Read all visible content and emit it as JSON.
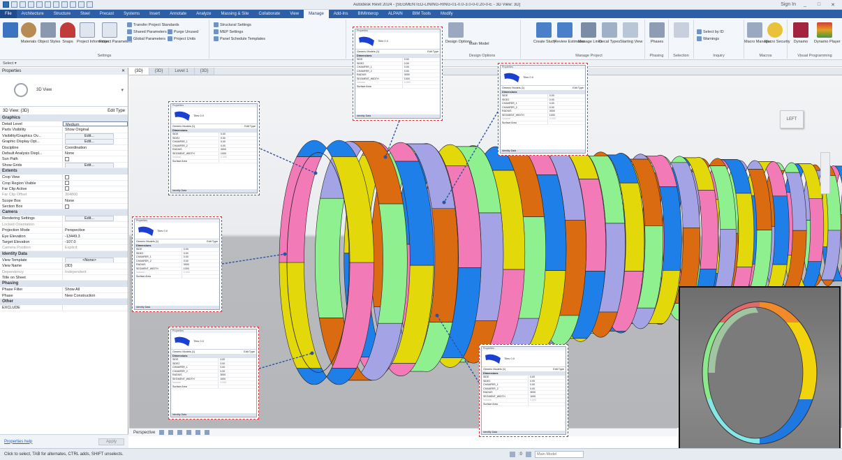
{
  "window": {
    "title": "Autodesk Revit 2024 - [SEGMENTED-LINING-RING-01-0.0-3.0-0-0.20-0-E - 3D View: 3D]",
    "user_label": "Sign In",
    "min": "_",
    "max": "□",
    "close": "✕"
  },
  "ribbon_tabs": [
    "File",
    "Architecture",
    "Structure",
    "Steel",
    "Precast",
    "Systems",
    "Insert",
    "Annotate",
    "Analyze",
    "Massing & Site",
    "Collaborate",
    "View",
    "Manage",
    "Add-Ins",
    "BIMInterop",
    "ALPAIN",
    "BIM Tools",
    "Modify"
  ],
  "active_tab": "Manage",
  "ribbon": {
    "settings": {
      "materials": "Materials",
      "object_styles": "Object Styles",
      "snaps": "Snaps",
      "project_info": "Project Information",
      "project_params": "Project Parameters",
      "shared_params": "Shared Parameters",
      "global_params": "Global Parameters",
      "transfer_standards": "Transfer Project Standards",
      "purge_unused": "Purge Unused",
      "project_units": "Project Units",
      "structural_settings": "Structural Settings",
      "mep_settings": "MEP Settings",
      "panel_schedule": "Panel Schedule Templates",
      "group": "Settings"
    },
    "design_options": {
      "label": "Design Options",
      "main_model": "Main Model",
      "group": "Design Options"
    },
    "manage_project": {
      "create_study": "Create Study",
      "review_estimates": "Review Estimates",
      "manage_links": "Manage Links",
      "decal_types": "Decal Types",
      "starting_view": "Starting View",
      "group": "Manage Project"
    },
    "phasing": {
      "phases": "Phases",
      "group": "Phasing"
    },
    "selection": {
      "group": "Selection"
    },
    "inquiry": {
      "select_by_id": "Select by ID",
      "warnings": "Warnings",
      "group": "Inquiry"
    },
    "macros": {
      "macro_manager": "Macro Manager",
      "macro_security": "Macro Security",
      "group": "Macros"
    },
    "visual_programming": {
      "dynamo": "Dynamo",
      "dynamo_player": "Dynamo Player",
      "group": "Visual Programming"
    }
  },
  "strip_label": "Select ▾",
  "properties": {
    "header": "Properties",
    "close": "✕",
    "type_name": "3D View",
    "instance_label": "3D View: {3D}",
    "edit_type": "Edit Type",
    "categories": [
      {
        "name": "Graphics",
        "rows": [
          {
            "k": "Detail Level",
            "v": "Medium",
            "t": "field"
          },
          {
            "k": "Parts Visibility",
            "v": "Show Original",
            "t": "text"
          },
          {
            "k": "Visibility/Graphics Ov...",
            "v": "Edit...",
            "t": "btn"
          },
          {
            "k": "Graphic Display Opt...",
            "v": "Edit...",
            "t": "btn"
          },
          {
            "k": "Discipline",
            "v": "Coordination",
            "t": "text"
          },
          {
            "k": "Default Analysis Displ...",
            "v": "None",
            "t": "text"
          },
          {
            "k": "Sun Path",
            "v": "",
            "t": "cb"
          },
          {
            "k": "Show Grids",
            "v": "Edit...",
            "t": "btn"
          }
        ]
      },
      {
        "name": "Extents",
        "rows": [
          {
            "k": "Crop View",
            "v": "",
            "t": "cb"
          },
          {
            "k": "Crop Region Visible",
            "v": "",
            "t": "cb"
          },
          {
            "k": "Far Clip Active",
            "v": "",
            "t": "cb"
          },
          {
            "k": "Far Clip Offset",
            "v": "304800",
            "t": "dim"
          },
          {
            "k": "Scope Box",
            "v": "None",
            "t": "text"
          },
          {
            "k": "Section Box",
            "v": "",
            "t": "cb"
          }
        ]
      },
      {
        "name": "Camera",
        "rows": [
          {
            "k": "Rendering Settings",
            "v": "Edit...",
            "t": "btn"
          },
          {
            "k": "Locked Orientation",
            "v": "",
            "t": "dim"
          },
          {
            "k": "Projection Mode",
            "v": "Perspective",
            "t": "text"
          },
          {
            "k": "Eye Elevation",
            "v": "-13449.3",
            "t": "text"
          },
          {
            "k": "Target Elevation",
            "v": "-107.0",
            "t": "text"
          },
          {
            "k": "Camera Position",
            "v": "Explicit",
            "t": "dim"
          }
        ]
      },
      {
        "name": "Identity Data",
        "rows": [
          {
            "k": "View Template",
            "v": "<None>",
            "t": "btn"
          },
          {
            "k": "View Name",
            "v": "{3D}",
            "t": "text"
          },
          {
            "k": "Dependency",
            "v": "Independent",
            "t": "dim"
          },
          {
            "k": "Title on Sheet",
            "v": "",
            "t": "text"
          }
        ]
      },
      {
        "name": "Phasing",
        "rows": [
          {
            "k": "Phase Filter",
            "v": "Show All",
            "t": "text"
          },
          {
            "k": "Phase",
            "v": "New Construction",
            "t": "text"
          }
        ]
      },
      {
        "name": "Other",
        "rows": [
          {
            "k": "EXCLUDE",
            "v": "",
            "t": "text"
          }
        ]
      }
    ],
    "help_link": "Properties help",
    "apply": "Apply"
  },
  "view_tabs": [
    "{3D}",
    "{3D}",
    "Level 1",
    "{3D}"
  ],
  "view_bar": {
    "mode": "Perspective",
    "icons": [
      "visual-style-icon",
      "sun-icon",
      "shadows-icon",
      "crop-icon",
      "reveal-icon",
      "temporary-hide-icon"
    ]
  },
  "viewcube_label": "LEFT",
  "status": {
    "text": "Click to select, TAB for alternates, CTRL adds, SHIFT unselects.",
    "main_model": ":0",
    "filter": "Main Model"
  },
  "callout": {
    "title": "Properties",
    "type_name": "Tiles 0.0",
    "type_sub": "0.0",
    "selector": "Generic Models (1)",
    "edit_type": "Edit Type",
    "category": "Dimensions",
    "footer": "Identity Data",
    "rows": [
      {
        "k": "SIDE",
        "v": "0.00"
      },
      {
        "k": "SIDE2",
        "v": "0.00"
      },
      {
        "k": "CHAMFER_1",
        "v": "0.00"
      },
      {
        "k": "CHAMFER_2",
        "v": "0.00"
      },
      {
        "k": "RADIUS",
        "v": "3000"
      },
      {
        "k": "SEGMENT_WIDTH",
        "v": "1000"
      },
      {
        "k": "Volume",
        "v": "0.000"
      },
      {
        "k": "Surface Area",
        "v": ""
      }
    ]
  },
  "colors": {
    "pink": "#f27bb7",
    "green": "#8ef08e",
    "blue": "#1f7fe8",
    "lavender": "#a3a3e6",
    "yellow": "#e2d80a",
    "orange": "#da6b10",
    "connector": "#2a52a5",
    "callout_border": "#e0313a"
  }
}
